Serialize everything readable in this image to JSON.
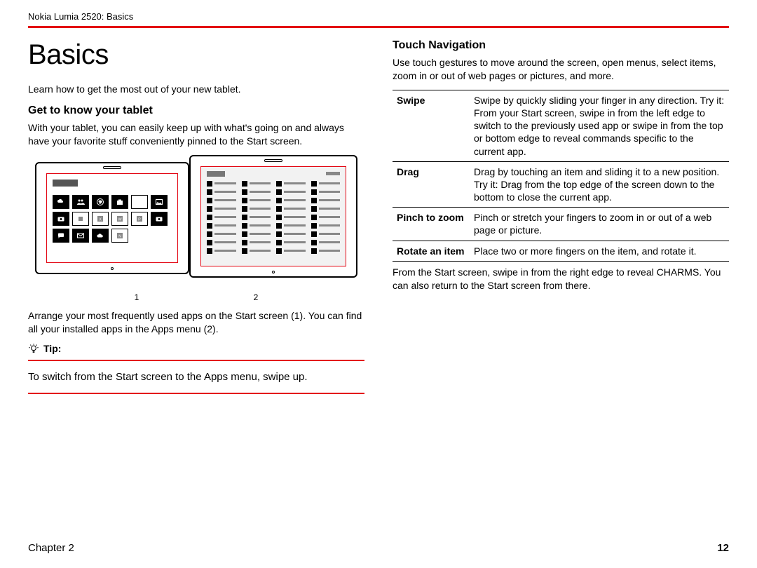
{
  "running_header": "Nokia Lumia 2520: Basics",
  "page_title": "Basics",
  "intro": "Learn how to get the most out of your new tablet.",
  "section1": {
    "heading": "Get to know your tablet",
    "body": "With your tablet, you can easily keep up with what's going on and always have your favorite stuff conveniently pinned to the Start screen.",
    "fig_label_1": "1",
    "fig_label_2": "2",
    "caption": "Arrange your most frequently used apps on the Start screen (1). You can find all your installed apps in the Apps menu (2)."
  },
  "tip": {
    "label": "Tip:",
    "body": "To switch from the Start screen to the Apps menu, swipe up."
  },
  "section2": {
    "heading": "Touch Navigation",
    "body": "Use touch gestures to move around the screen, open menus, select items, zoom in or out of web pages or pictures, and more.",
    "gestures": [
      {
        "term": "Swipe",
        "desc": "Swipe by quickly sliding your finger in any direction. Try it: From your Start screen, swipe in from the left edge to switch to the previously used app or swipe in from the top or bottom edge to reveal commands specific to the current app."
      },
      {
        "term": "Drag",
        "desc": "Drag by touching an item and sliding it to a new position.\nTry it: Drag from the top edge of the screen down to the bottom to close the current app."
      },
      {
        "term": "Pinch to zoom",
        "desc": "Pinch or stretch your fingers to zoom in or out of a web page or picture."
      },
      {
        "term": "Rotate an item",
        "desc": "Place two or more fingers on the item, and rotate it."
      }
    ],
    "after": "From the Start screen, swipe in from the right edge to reveal CHARMS. You can also return to the Start screen from there."
  },
  "footer": {
    "chapter": "Chapter 2",
    "page": "12"
  }
}
